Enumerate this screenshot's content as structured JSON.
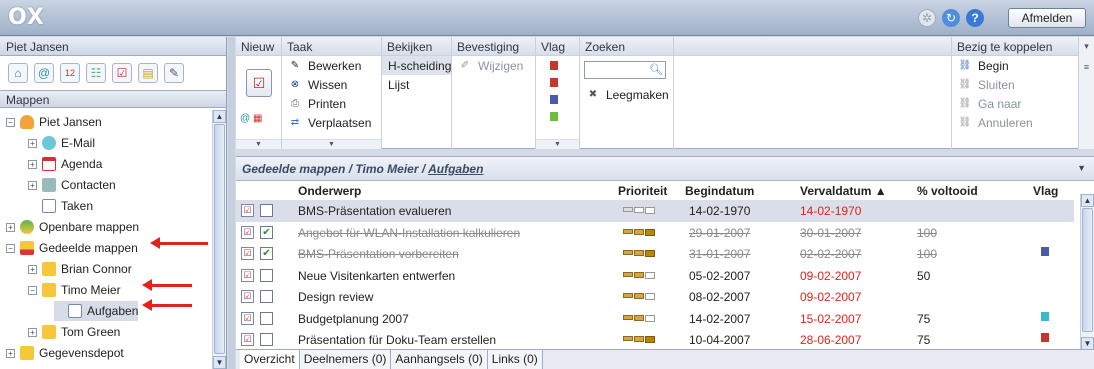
{
  "app": {
    "logo": "OX",
    "logout_label": "Afmelden"
  },
  "top_icons": [
    "gear-icon",
    "refresh-icon",
    "help-icon"
  ],
  "left": {
    "user_title": "Piet Jansen",
    "app_icons": [
      "home-icon",
      "email-icon",
      "calendar-icon",
      "contacts-icon",
      "tasks-icon",
      "infostore-icon",
      "settings-icon"
    ],
    "mappen_title": "Mappen",
    "tree": [
      {
        "label": "Piet Jansen",
        "indent": 0,
        "exp": "−",
        "icon": "user"
      },
      {
        "label": "E-Mail",
        "indent": 1,
        "exp": "+",
        "icon": "mail"
      },
      {
        "label": "Agenda",
        "indent": 1,
        "exp": "+",
        "icon": "cal"
      },
      {
        "label": "Contacten",
        "indent": 1,
        "exp": "+",
        "icon": "contact"
      },
      {
        "label": "Taken",
        "indent": 1,
        "exp": "",
        "icon": "task"
      },
      {
        "label": "Openbare mappen",
        "indent": 0,
        "exp": "+",
        "icon": "globe"
      },
      {
        "label": "Gedeelde mappen",
        "indent": 0,
        "exp": "−",
        "icon": "shared"
      },
      {
        "label": "Brian Connor",
        "indent": 1,
        "exp": "+",
        "icon": "folder"
      },
      {
        "label": "Timo Meier",
        "indent": 1,
        "exp": "−",
        "icon": "folder"
      },
      {
        "label": "Aufgaben",
        "indent": 2,
        "exp": "",
        "icon": "task"
      },
      {
        "label": "Tom Green",
        "indent": 1,
        "exp": "+",
        "icon": "folder"
      },
      {
        "label": "Gegevensdepot",
        "indent": 0,
        "exp": "+",
        "icon": "folder"
      }
    ]
  },
  "toolbar": {
    "nieuw": "Nieuw",
    "taak": {
      "head": "Taak",
      "items": [
        "Bewerken",
        "Wissen",
        "Printen",
        "Verplaatsen"
      ]
    },
    "bekijken": {
      "head": "Bekijken",
      "items": [
        "H-scheiding",
        "Lijst"
      ]
    },
    "bevestiging": {
      "head": "Bevestiging",
      "items": [
        "Wijzigen"
      ]
    },
    "vlag": {
      "head": "Vlag"
    },
    "zoeken": {
      "head": "Zoeken",
      "search_placeholder": "",
      "clear": "Leegmaken"
    },
    "koppelen": {
      "head": "Bezig te koppelen",
      "items": [
        "Begin",
        "Sluiten",
        "Ga naar",
        "Annuleren"
      ]
    }
  },
  "content": {
    "breadcrumb": {
      "part1": "Gedeelde mappen",
      "sep": " / ",
      "part2": "Timo Meier",
      "part3": "Aufgaben"
    },
    "headers": {
      "onderwerp": "Onderwerp",
      "prioriteit": "Prioriteit",
      "begindatum": "Begindatum",
      "vervaldatum": "Vervaldatum ▲",
      "voltooid": "% voltooid",
      "vlag": "Vlag"
    },
    "rows": [
      {
        "subject": "BMS-Präsentation evalueren",
        "prio": 1,
        "start": "14-02-1970",
        "due": "14-02-1970",
        "due_red": true,
        "done": "",
        "checked": false,
        "strike": false,
        "flag": "",
        "selected": true
      },
      {
        "subject": "Angebot für WLAN-Installation kalkulieren",
        "prio": 3,
        "start": "29-01-2007",
        "due": "30-01-2007",
        "due_red": false,
        "done": "100",
        "checked": true,
        "strike": true,
        "flag": "",
        "selected": false
      },
      {
        "subject": "BMS-Präsentation vorbereiten",
        "prio": 3,
        "start": "31-01-2007",
        "due": "02-02-2007",
        "due_red": false,
        "done": "100",
        "checked": true,
        "strike": true,
        "flag": "#4a5ca8",
        "selected": false
      },
      {
        "subject": "Neue Visitenkarten entwerfen",
        "prio": 2,
        "start": "05-02-2007",
        "due": "09-02-2007",
        "due_red": true,
        "done": "50",
        "checked": false,
        "strike": false,
        "flag": "",
        "selected": false
      },
      {
        "subject": "Design review",
        "prio": 2,
        "start": "08-02-2007",
        "due": "09-02-2007",
        "due_red": true,
        "done": "",
        "checked": false,
        "strike": false,
        "flag": "",
        "selected": false
      },
      {
        "subject": "Budgetplanung 2007",
        "prio": 2,
        "start": "14-02-2007",
        "due": "15-02-2007",
        "due_red": true,
        "done": "75",
        "checked": false,
        "strike": false,
        "flag": "#3cb8c8",
        "selected": false
      },
      {
        "subject": "Präsentation für Doku-Team erstellen",
        "prio": 3,
        "start": "10-04-2007",
        "due": "28-06-2007",
        "due_red": true,
        "done": "75",
        "checked": false,
        "strike": false,
        "flag": "#c0392b",
        "selected": false
      }
    ]
  },
  "tabs": [
    "Overzicht",
    "Deelnemers (0)",
    "Aanhangsels (0)",
    "Links (0)"
  ]
}
